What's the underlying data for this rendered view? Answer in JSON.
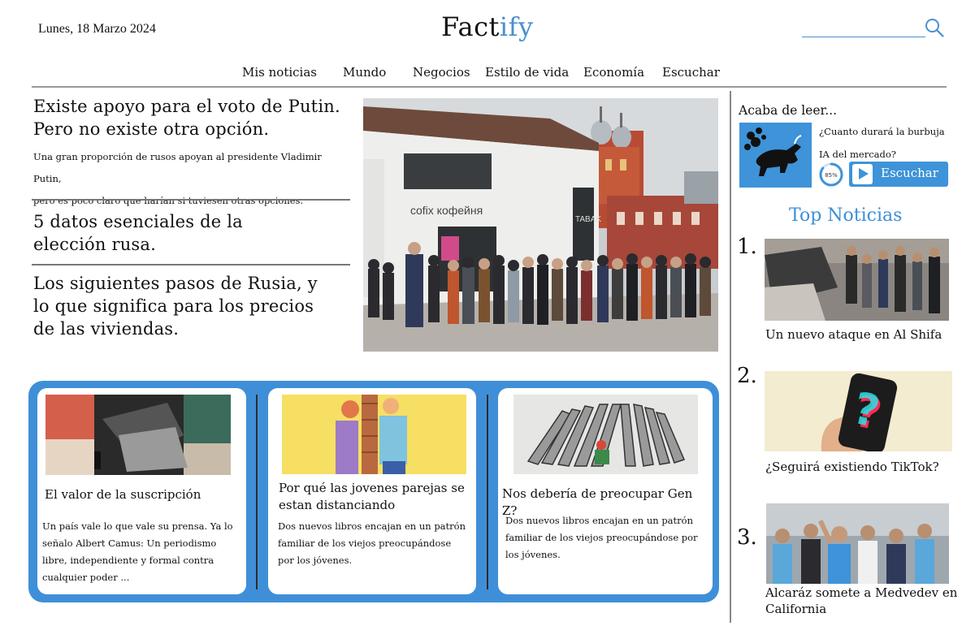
{
  "header": {
    "date": "Lunes, 18 Marzo 2024",
    "logo_main": "Fact",
    "logo_accent": "ify",
    "accent_color": "#4a8fcf"
  },
  "nav": {
    "items": [
      "Mis noticias",
      "Mundo",
      "Negocios",
      "Estilo de vida",
      "Economía",
      "Escuchar"
    ]
  },
  "stories": [
    {
      "headline": "Existe apoyo para el voto de Putin. Pero no existe otra opción.",
      "summary_line1": "Una gran proporción de rusos apoyan al presidente Vladimir Putin,",
      "summary_line2": "pero es poco claro que harían si tuviesen otras opciones."
    },
    {
      "headline": "5 datos esenciales de la elección rusa."
    },
    {
      "headline": "Los siguientes pasos de Rusia, y lo que significa para los precios de las viviendas."
    }
  ],
  "hero": {
    "sign": "cofix кофейня",
    "shop": "TABAK"
  },
  "cards": [
    {
      "title": "El valor de la suscripción",
      "body": "Un país vale lo que vale su prensa. Ya lo señalo Albert Camus: Un periodismo libre, independiente y formal contra cualquier poder ..."
    },
    {
      "title": "Por qué las jovenes parejas se estan distanciando",
      "body": "Dos nuevos libros encajan en un patrón familiar de los viejos preocupándose por los jóvenes."
    },
    {
      "title": "Nos debería de preocupar Gen Z?",
      "body": "Dos nuevos libros encajan en un patrón familiar de los viejos preocupándose por los jóvenes."
    }
  ],
  "just_read": {
    "label": "Acaba de leer...",
    "title": "¿Cuanto durará la burbuja IA del mercado?",
    "progress_label": "85%",
    "progress_value": 85,
    "listen_label": "Escuchar"
  },
  "top_news": {
    "title": "Top Noticias",
    "items": [
      {
        "rank": "1.",
        "caption": "Un nuevo ataque en Al Shifa"
      },
      {
        "rank": "2.",
        "caption": "¿Seguirá existiendo TikTok?"
      },
      {
        "rank": "3.",
        "caption": "Alcaráz somete a Medvedev en California"
      }
    ]
  }
}
